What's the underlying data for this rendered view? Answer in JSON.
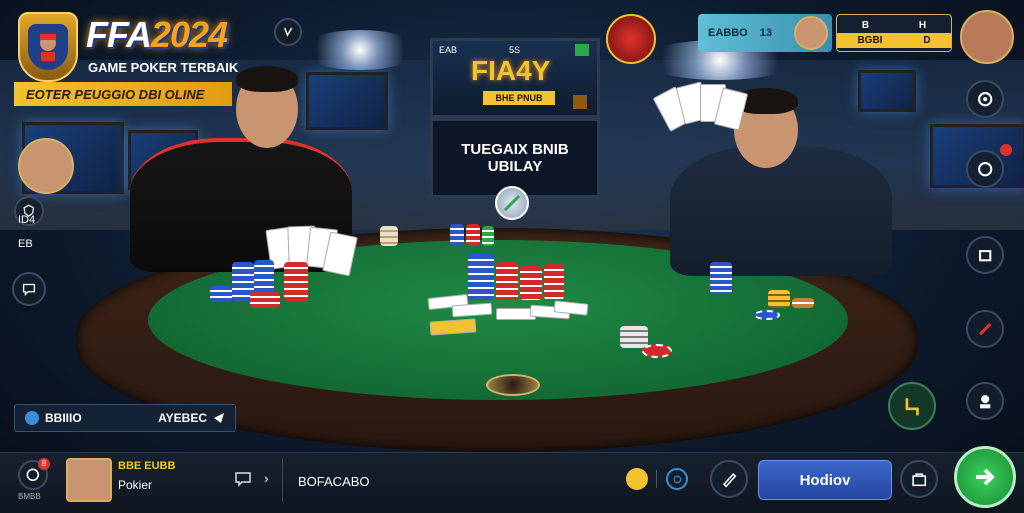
{
  "brand": {
    "title_main": "FFA",
    "title_accent": "2024",
    "subtitle": "GAME POKER TERBAIK",
    "banner": "EOTER   PEUGGIO DBI OLINE"
  },
  "center_screen": {
    "badge_left": "EAB",
    "badge_mid": "5S",
    "title": "FIA4Y",
    "subtitle": "BHE PNUB",
    "line1": "TUEGAIX BNIB",
    "line2": "UBILAY"
  },
  "top_right": {
    "panel1_left": "EABBO",
    "panel1_value": "13",
    "panel2_a": "B",
    "panel2_b": "H",
    "panel2_c": "BGBI",
    "panel2_d": "D"
  },
  "left_sidebar": {
    "label1": "ID4",
    "label2": "EB"
  },
  "player_left_card": {
    "name": "BBIIIO",
    "value": "AYEBEC"
  },
  "bottom_bar": {
    "profile_label": "BMBB",
    "player_name": "BBE EUBB",
    "player_sub": "Pokier",
    "arrow": "›",
    "center_text": "BOFACABO",
    "play_button": "Hodiov",
    "badge_count": "8"
  },
  "colors": {
    "accent": "#f7a21a",
    "felt": "#1f8a46",
    "play_button": "#2f57b4",
    "go_button": "#2cba4d"
  },
  "icons": [
    "settings-icon",
    "camera-icon",
    "share-icon",
    "edit-icon",
    "profile-icon",
    "chat-icon",
    "wallet-icon",
    "lock-icon",
    "arrow-right-icon"
  ]
}
